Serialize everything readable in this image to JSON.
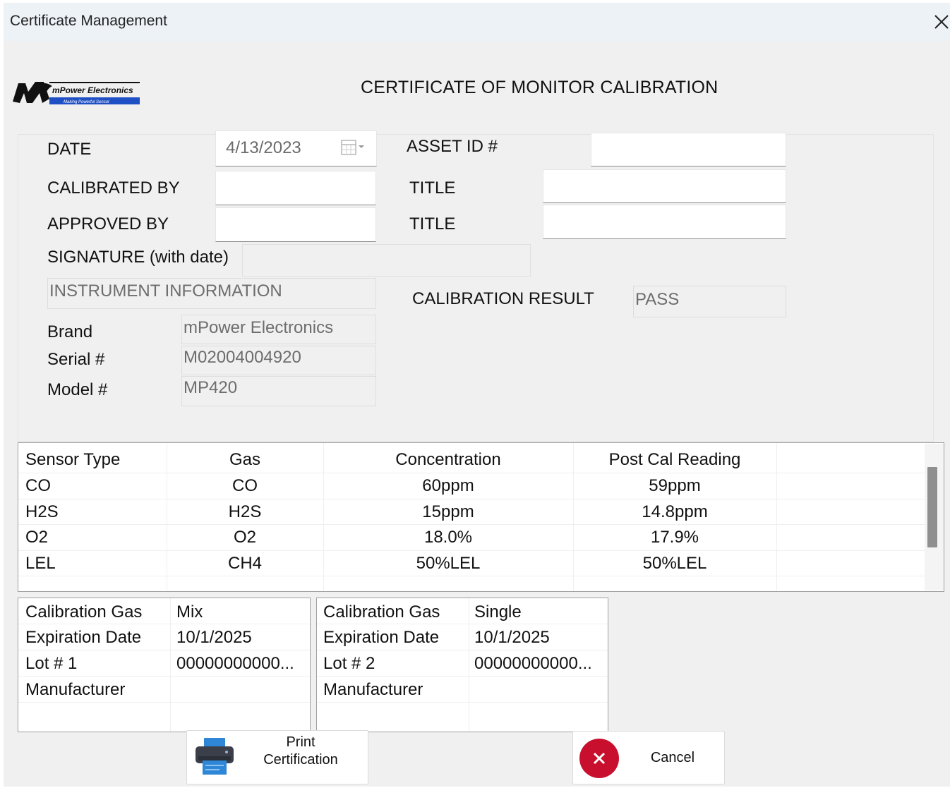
{
  "window": {
    "title": "Certificate Management"
  },
  "header": {
    "doc_title": "CERTIFICATE OF MONITOR CALIBRATION",
    "logo": {
      "brand": "mPower Electronics",
      "tagline": "Making Powerful Sensor"
    }
  },
  "form": {
    "date_label": "DATE",
    "date_value": "4/13/2023",
    "asset_id_label": "ASSET ID #",
    "asset_id_value": "",
    "calibrated_by_label": "CALIBRATED BY",
    "calibrated_by_value": "",
    "title_label_1": "TITLE",
    "title_value_1": "",
    "approved_by_label": "APPROVED BY",
    "approved_by_value": "",
    "title_label_2": "TITLE",
    "title_value_2": "",
    "signature_label": "SIGNATURE (with date)",
    "signature_value": "",
    "instrument_info_label": "INSTRUMENT INFORMATION",
    "calibration_result_label": "CALIBRATION RESULT",
    "calibration_result_value": "PASS",
    "brand_label": "Brand",
    "brand_value": "mPower Electronics",
    "serial_label": "Serial #",
    "serial_value": "M02004004920",
    "model_label": "Model #",
    "model_value": "MP420"
  },
  "sensor_table": {
    "columns": [
      "Sensor Type",
      "Gas",
      "Concentration",
      "Post Cal Reading"
    ],
    "rows": [
      [
        "CO",
        "CO",
        "60ppm",
        "59ppm"
      ],
      [
        "H2S",
        "H2S",
        "15ppm",
        "14.8ppm"
      ],
      [
        "O2",
        "O2",
        "18.0%",
        "17.9%"
      ],
      [
        "LEL",
        "CH4",
        "50%LEL",
        "50%LEL"
      ]
    ]
  },
  "gas_tables": [
    {
      "rows": [
        [
          "Calibration Gas",
          "Mix"
        ],
        [
          "Expiration Date",
          "10/1/2025"
        ],
        [
          "Lot # 1",
          "00000000000..."
        ],
        [
          "Manufacturer",
          ""
        ]
      ]
    },
    {
      "rows": [
        [
          "Calibration Gas",
          "Single"
        ],
        [
          "Expiration Date",
          "10/1/2025"
        ],
        [
          "Lot # 2",
          "00000000000..."
        ],
        [
          "Manufacturer",
          ""
        ]
      ]
    }
  ],
  "buttons": {
    "print_label_line1": "Print",
    "print_label_line2": "Certification",
    "cancel_label": "Cancel"
  },
  "colors": {
    "cancel_red": "#c8102e",
    "printer_blue": "#2e86d6",
    "logo_blue": "#1f4fc4"
  },
  "icons": {
    "close": "close-icon",
    "calendar": "calendar-icon",
    "printer": "printer-icon",
    "cancel": "cancel-x-icon"
  }
}
